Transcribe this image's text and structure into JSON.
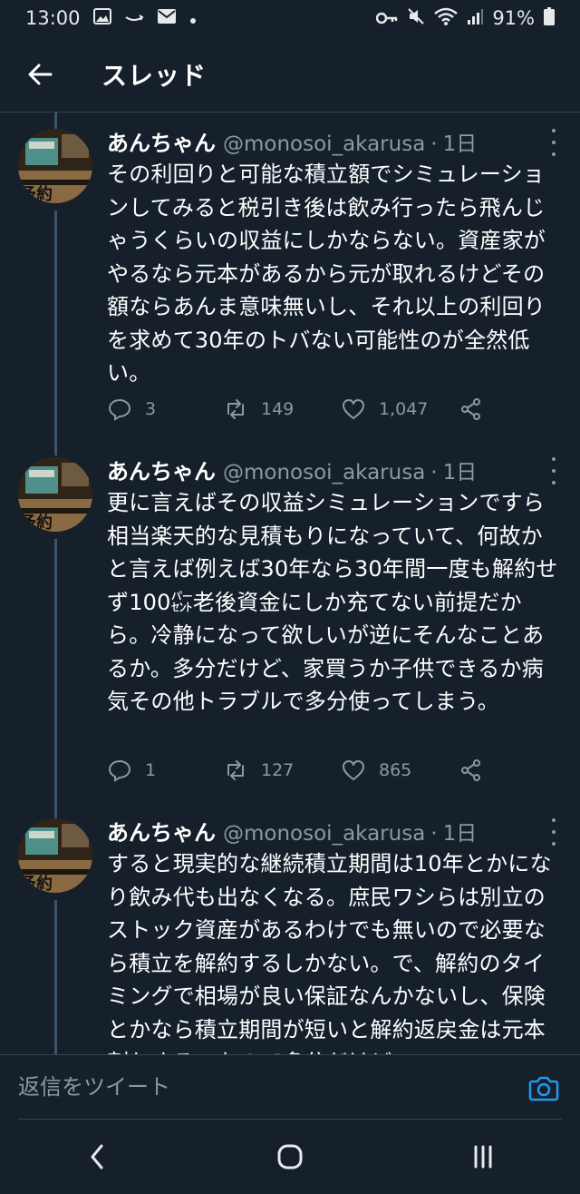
{
  "status_bar": {
    "time": "13:00",
    "battery": "91%"
  },
  "header": {
    "title": "スレッド"
  },
  "tweets": [
    {
      "name": "あんちゃん",
      "handle": "@monosoi_akarusa",
      "separator": "·",
      "time": "1日",
      "text": "その利回りと可能な積立額でシミュレーションしてみると税引き後は飲み行ったら飛んじゃうくらいの収益にしかならない。資産家がやるなら元本があるから元が取れるけどその額ならあんま意味無いし、それ以上の利回りを求めて30年のトバない可能性のが全然低い。",
      "replies": "3",
      "retweets": "149",
      "likes": "1,047"
    },
    {
      "name": "あんちゃん",
      "handle": "@monosoi_akarusa",
      "separator": "·",
      "time": "1日",
      "text": "更に言えばその収益シミュレーションですら相当楽天的な見積もりになっていて、何故かと言えば例えば30年なら30年間一度も解約せず100㌫老後資金にしか充てない前提だから。冷静になって欲しいが逆にそんなことあるか。多分だけど、家買うか子供できるか病気その他トラブルで多分使ってしまう。",
      "replies": "1",
      "retweets": "127",
      "likes": "865"
    },
    {
      "name": "あんちゃん",
      "handle": "@monosoi_akarusa",
      "separator": "·",
      "time": "1日",
      "text": "すると現実的な継続積立期間は10年とかになり飲み代も出なくなる。庶民ワシらは別立のストック資産があるわけでも無いので必要なら積立を解約するしかない。で、解約のタイミングで相場が良い保証なんかないし、保険とかなら積立期間が短いと解約返戻金は元本割れする。なので多分だけど",
      "replies": "",
      "retweets": "",
      "likes": ""
    }
  ],
  "reply_bar": {
    "placeholder": "返信をツイート"
  },
  "icons": {
    "back": "arrow-left-icon",
    "more": "more-vertical-icon",
    "reply": "comment-icon",
    "retweet": "retweet-icon",
    "like": "heart-icon",
    "share": "share-icon",
    "camera": "camera-icon"
  },
  "colors": {
    "background": "#15202b",
    "text": "#ffffff",
    "secondary_text": "#8b98a5",
    "accent": "#1d9bf0",
    "divider": "#38444d"
  }
}
